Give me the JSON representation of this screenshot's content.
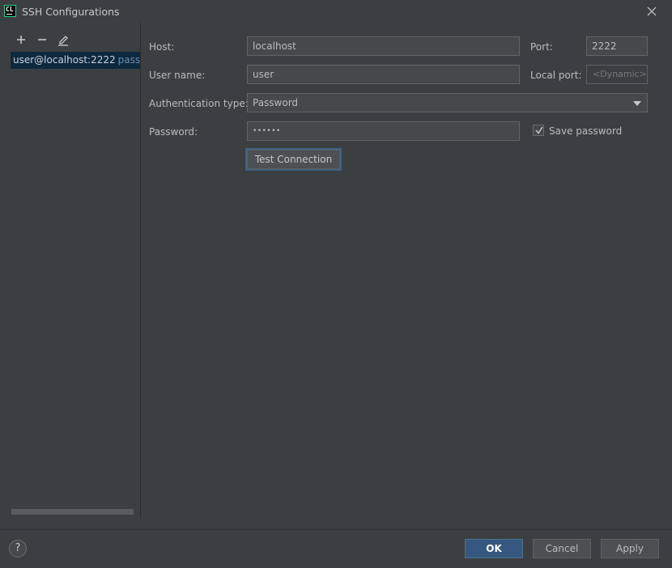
{
  "window": {
    "title": "SSH Configurations",
    "app_icon": "CL",
    "close_icon": "close-icon"
  },
  "sidebar": {
    "toolbar": [
      {
        "name": "add-icon"
      },
      {
        "name": "remove-icon"
      },
      {
        "name": "edit-icon"
      }
    ],
    "items": [
      {
        "label": "user@localhost:2222",
        "auth": "password",
        "selected": true
      }
    ]
  },
  "form": {
    "host": {
      "label": "Host:",
      "value": "localhost"
    },
    "port": {
      "label": "Port:",
      "value": "2222"
    },
    "username": {
      "label": "User name:",
      "value": "user"
    },
    "local_port": {
      "label": "Local port:",
      "placeholder": "<Dynamic>"
    },
    "auth_type": {
      "label": "Authentication type:",
      "value": "Password"
    },
    "password": {
      "label": "Password:",
      "value": "••••••"
    },
    "save_password": {
      "label": "Save password",
      "checked": true
    },
    "test_connection": "Test Connection"
  },
  "footer": {
    "help": "?",
    "ok": "OK",
    "cancel": "Cancel",
    "apply": "Apply"
  },
  "colors": {
    "background": "#3c3f41",
    "selection": "#0d293e",
    "primary_button": "#365880",
    "focus_ring": "#3d6185"
  }
}
